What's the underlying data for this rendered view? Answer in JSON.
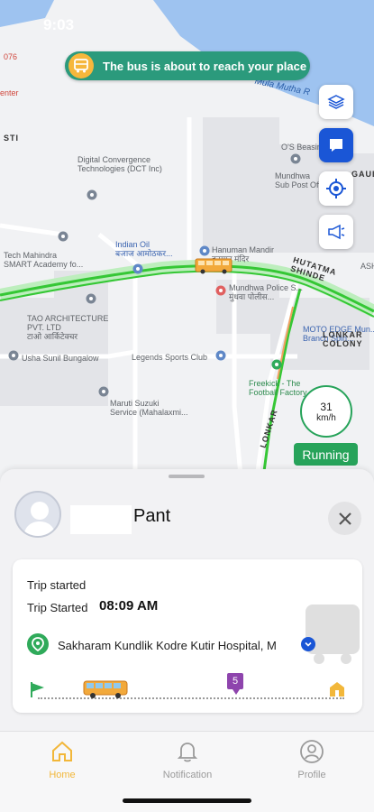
{
  "status_bar": {
    "time": "9:03"
  },
  "banner": {
    "text": "The bus is about to reach your place",
    "color": "#2b9a7c"
  },
  "map": {
    "labels": {
      "river": "Mula Mutha R",
      "digital": "Digital Convergence\nTechnologies (DCT Inc)",
      "tech_mahindra": "Tech Mahindra\nSMART Academy fo...",
      "indian_oil": "Indian Oil\nबजाज आमोठकर...",
      "hanuman": "Hanuman Mandir\nहनुमान मंदिर",
      "os_beasin": "O'S Beasin",
      "mundhwa_sub": "Mundhwa\nSub Post Office",
      "road_main": "HUTATMA SHINDE",
      "mundhwa_police": "Mundhwa Police S...\nमुंधवा पोलीस...",
      "tao": "TAO ARCHITECTURE\nPVT. LTD\nटाओ आर्किटेक्चर",
      "usha": "Usha Sunil Bungalow",
      "legends": "Legends Sports Club",
      "moto": "MOTO EDGE Mun...\nBranch Spin...",
      "lonkar": "LONKAR\nCOLONY",
      "maruti": "Maruti Suzuki\nService (Mahalaxmi...",
      "freekick": "Freekick - The\nFootball Factory",
      "lonkar_road": "LONKAR",
      "pashi": "ASHI",
      "enter": "enter",
      "gaul": "GAUL",
      "sti": "STI",
      "num": "076"
    }
  },
  "controls": {
    "layers": "layers-icon",
    "chat": "chat-icon",
    "locate": "locate-icon",
    "announce": "megaphone-icon"
  },
  "speed": {
    "value": "31",
    "unit": "km/h"
  },
  "status_badge": "Running",
  "driver": {
    "name": "Pant"
  },
  "trip": {
    "line1": "Trip started",
    "line2_label": "Trip Started",
    "time": "08:09 AM",
    "stop": "Sakharam Kundlik Kodre Kutir Hospital, M",
    "stop_count": "5"
  },
  "tabs": [
    {
      "label": "Home",
      "icon": "home-icon"
    },
    {
      "label": "Notification",
      "icon": "bell-icon"
    },
    {
      "label": "Profile",
      "icon": "profile-icon"
    }
  ],
  "colors": {
    "accent": "#f2b73a",
    "green": "#27a35a",
    "route": "#35c735",
    "primary_blue": "#1a56d6"
  }
}
